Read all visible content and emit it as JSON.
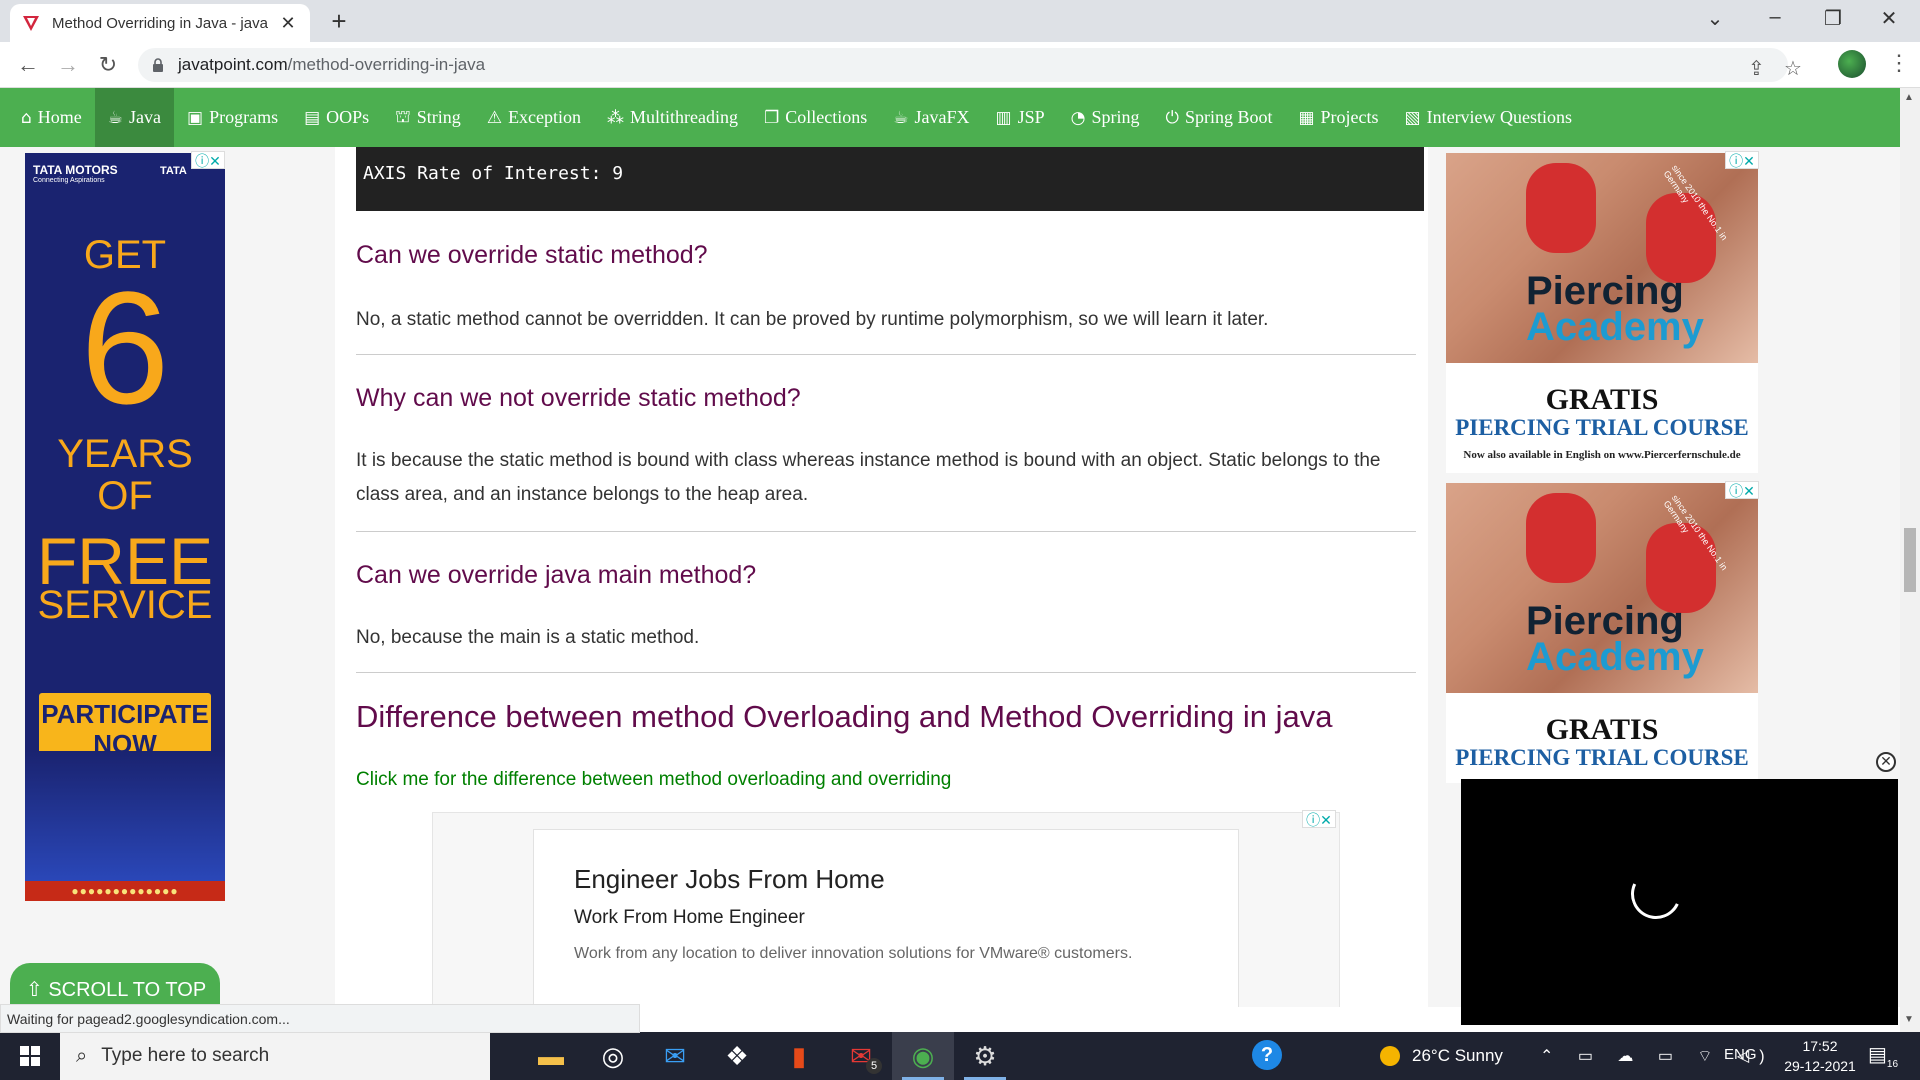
{
  "browser": {
    "tab_title": "Method Overriding in Java - java",
    "url_domain": "javatpoint.com",
    "url_path": "/method-overriding-in-java"
  },
  "sitenav": {
    "items": [
      {
        "label": "Home",
        "icon": "home-icon"
      },
      {
        "label": "Java",
        "icon": "java-cup-icon",
        "active": true
      },
      {
        "label": "Programs",
        "icon": "monitor-icon"
      },
      {
        "label": "OOPs",
        "icon": "oops-icon"
      },
      {
        "label": "String",
        "icon": "string-icon"
      },
      {
        "label": "Exception",
        "icon": "warning-icon"
      },
      {
        "label": "Multithreading",
        "icon": "threads-icon"
      },
      {
        "label": "Collections",
        "icon": "collections-icon"
      },
      {
        "label": "JavaFX",
        "icon": "javafx-icon"
      },
      {
        "label": "JSP",
        "icon": "jsp-icon"
      },
      {
        "label": "Spring",
        "icon": "spring-icon"
      },
      {
        "label": "Spring Boot",
        "icon": "power-icon"
      },
      {
        "label": "Projects",
        "icon": "projects-icon"
      },
      {
        "label": "Interview Questions",
        "icon": "interview-icon"
      }
    ]
  },
  "content": {
    "code_output": "AXIS Rate of Interest: 9",
    "sections": [
      {
        "heading": "Can we override static method?",
        "text": "No, a static method cannot be overridden. It can be proved by runtime polymorphism, so we will learn it later."
      },
      {
        "heading": "Why can we not override static method?",
        "text": "It is because the static method is bound with class whereas instance method is bound with an object. Static belongs to the class area, and an instance belongs to the heap area."
      },
      {
        "heading": "Can we override java main method?",
        "text": "No, because the main is a static method."
      }
    ],
    "big_heading": "Difference between method Overloading and Method Overriding in java",
    "link_text": "Click me for the difference between method overloading and overriding"
  },
  "ad_center": {
    "title": "Engineer Jobs From Home",
    "subtitle": "Work From Home Engineer",
    "description": "Work from any location to deliver innovation solutions for VMware® customers."
  },
  "ad_tata": {
    "brand": "TATA MOTORS",
    "tagline": "Connecting Aspirations",
    "brand2": "TATA",
    "get": "GET",
    "number": "6",
    "years": "YEARS",
    "of": "OF",
    "free": "FREE",
    "service": "SERVICE",
    "cta_line1": "PARTICIPATE",
    "cta_line2": "NOW"
  },
  "ad_piercing": {
    "badge": "since 2010 the No.1 in Germany",
    "title_line1": "Piercing",
    "title_line2": "Academy",
    "gratis": "GRATIS",
    "course": "PIERCING TRIAL COURSE",
    "note": "Now also available in English on www.Piercerfernschule.de"
  },
  "scroll_top_label": "⇧ SCROLL TO TOP",
  "status_text": "Waiting for pagead2.googlesyndication.com...",
  "taskbar": {
    "search_placeholder": "Type here to search",
    "weather": "26°C  Sunny",
    "lang": "ENG",
    "time": "17:52",
    "date": "29-12-2021",
    "notif_count": "16",
    "gmail_badge": "5"
  }
}
